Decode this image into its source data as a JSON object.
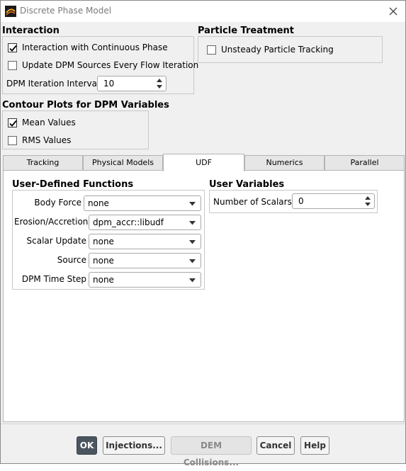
{
  "window": {
    "title": "Discrete Phase Model",
    "icon": "ansys-icon",
    "close": "close-icon"
  },
  "interaction": {
    "title": "Interaction",
    "continuous_phase": {
      "label": "Interaction with Continuous Phase",
      "checked": true
    },
    "update_sources": {
      "label": "Update DPM Sources Every Flow Iteration",
      "checked": false
    },
    "iteration_interval": {
      "label": "DPM Iteration Interval",
      "value": "10"
    }
  },
  "particle_treatment": {
    "title": "Particle Treatment",
    "unsteady": {
      "label": "Unsteady Particle Tracking",
      "checked": false
    }
  },
  "contour_plots": {
    "title": "Contour Plots for DPM Variables",
    "mean": {
      "label": "Mean Values",
      "checked": true
    },
    "rms": {
      "label": "RMS Values",
      "checked": false
    }
  },
  "tabs": [
    {
      "label": "Tracking"
    },
    {
      "label": "Physical Models"
    },
    {
      "label": "UDF"
    },
    {
      "label": "Numerics"
    },
    {
      "label": "Parallel"
    }
  ],
  "active_tab": "UDF",
  "udf": {
    "title": "User-Defined Functions",
    "body_force": {
      "label": "Body Force",
      "value": "none"
    },
    "erosion": {
      "label": "Erosion/Accretion",
      "value": "dpm_accr::libudf"
    },
    "scalar_update": {
      "label": "Scalar Update",
      "value": "none"
    },
    "source": {
      "label": "Source",
      "value": "none"
    },
    "time_step": {
      "label": "DPM Time Step",
      "value": "none"
    }
  },
  "user_variables": {
    "title": "User Variables",
    "num_scalars": {
      "label": "Number of Scalars",
      "value": "0"
    }
  },
  "buttons": {
    "ok": "OK",
    "injections": "Injections...",
    "dem": "DEM Collisions...",
    "cancel": "Cancel",
    "help": "Help"
  },
  "colors": {
    "primary_button": "#4a5560",
    "panel": "#f0f0f0",
    "tab_active": "#ffffff"
  }
}
